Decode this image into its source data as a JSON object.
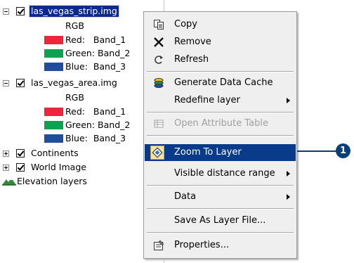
{
  "layers": {
    "strip": {
      "name": "las_vegas_strip.img",
      "composite": "RGB",
      "bands": [
        {
          "text": "Red:   Band_1",
          "color": "#f0253c"
        },
        {
          "text": "Green: Band_2",
          "color": "#0fa152"
        },
        {
          "text": "Blue:  Band_3",
          "color": "#1f4f9c"
        }
      ]
    },
    "area": {
      "name": "las_vegas_area.img",
      "composite": "RGB",
      "bands": [
        {
          "text": "Red:   Band_1",
          "color": "#f0253c"
        },
        {
          "text": "Green: Band_2",
          "color": "#0fa152"
        },
        {
          "text": "Blue:  Band_3",
          "color": "#1f4f9c"
        }
      ]
    },
    "continents": {
      "name": "Continents"
    },
    "world_image": {
      "name": "World Image"
    },
    "elevation": {
      "name": "Elevation layers"
    }
  },
  "context_menu": {
    "copy": "Copy",
    "remove": "Remove",
    "refresh": "Refresh",
    "generate_data_cache": "Generate Data Cache",
    "redefine_layer": "Redefine layer",
    "open_attribute_table": "Open Attribute Table",
    "zoom_to_layer": "Zoom To Layer",
    "visible_distance_range": "Visible distance range",
    "data": "Data",
    "save_as_layer_file": "Save As Layer File...",
    "properties": "Properties..."
  },
  "callout": {
    "number": "1"
  },
  "icons": {
    "copy": "copy-icon",
    "remove": "remove-x-icon",
    "refresh": "refresh-icon",
    "cache": "data-cache-icon",
    "table": "attribute-table-icon",
    "zoom": "zoom-to-layer-icon",
    "properties": "properties-icon",
    "elevation": "elevation-layers-icon"
  },
  "colors": {
    "selection": "#0a2a8c",
    "menu_highlight": "#0a3a8a",
    "callout": "#0b3f78"
  }
}
